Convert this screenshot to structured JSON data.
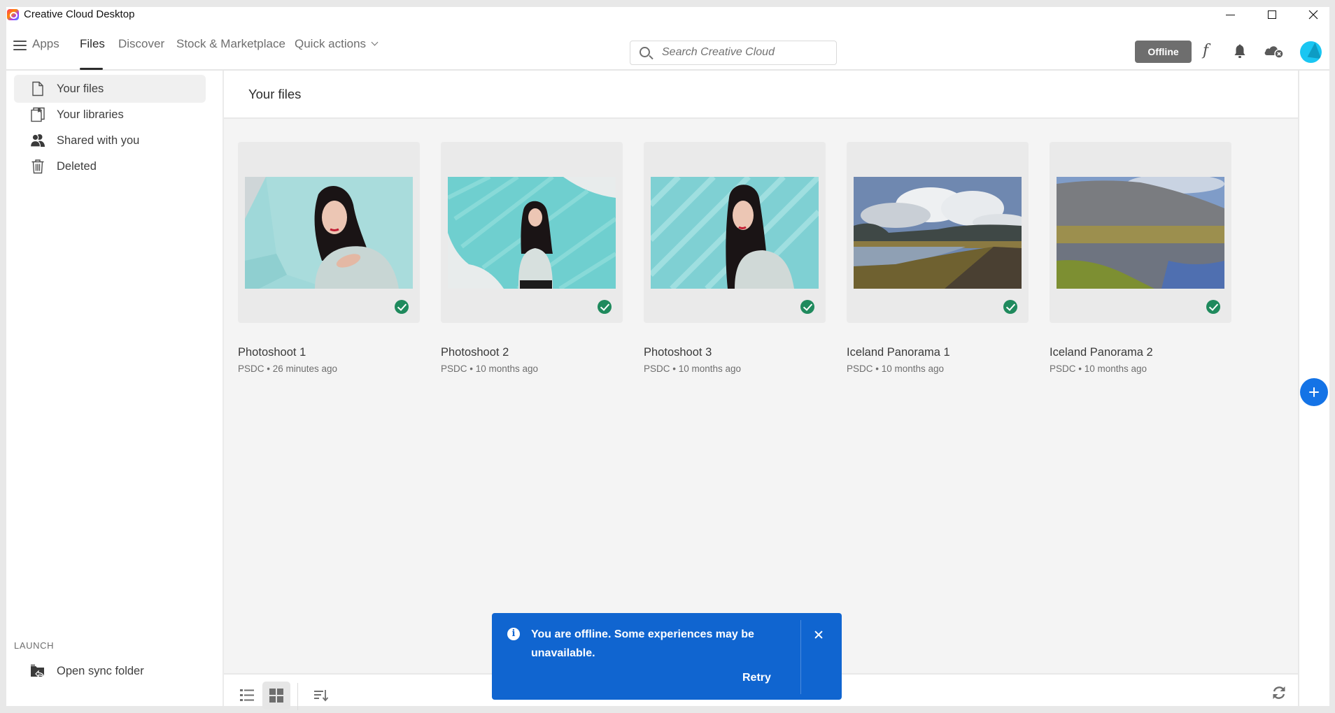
{
  "window": {
    "title": "Creative Cloud Desktop",
    "controls": {
      "minimize": "minimize",
      "maximize": "maximize",
      "close": "close"
    }
  },
  "nav": {
    "tabs": [
      {
        "label": "Apps",
        "active": false
      },
      {
        "label": "Files",
        "active": true
      },
      {
        "label": "Discover",
        "active": false
      },
      {
        "label": "Stock & Marketplace",
        "active": false
      },
      {
        "label": "Quick actions",
        "active": false,
        "dropdown": true
      }
    ],
    "search": {
      "placeholder": "Search Creative Cloud",
      "value": ""
    },
    "status_button": "Offline",
    "icons": [
      "fonts-icon",
      "bell-icon",
      "cloud-offline-icon",
      "avatar"
    ],
    "font_glyph": "f"
  },
  "sidebar": {
    "items": [
      {
        "label": "Your files",
        "icon": "file-icon",
        "active": true
      },
      {
        "label": "Your libraries",
        "icon": "libraries-icon",
        "active": false
      },
      {
        "label": "Shared with you",
        "icon": "people-icon",
        "active": false
      },
      {
        "label": "Deleted",
        "icon": "trash-icon",
        "active": false
      }
    ],
    "section_label": "LAUNCH",
    "launch_items": [
      {
        "label": "Open sync folder",
        "icon": "sync-folder-icon"
      }
    ]
  },
  "main": {
    "title": "Your files",
    "files": [
      {
        "name": "Photoshoot 1",
        "meta": "PSDC • 26 minutes ago",
        "synced": true
      },
      {
        "name": "Photoshoot 2",
        "meta": "PSDC • 10 months ago",
        "synced": true
      },
      {
        "name": "Photoshoot 3",
        "meta": "PSDC • 10 months ago",
        "synced": true
      },
      {
        "name": "Iceland Panorama 1",
        "meta": "PSDC • 10 months ago",
        "synced": true
      },
      {
        "name": "Iceland Panorama 2",
        "meta": "PSDC • 10 months ago",
        "synced": true
      }
    ],
    "view_mode": "grid"
  },
  "toast": {
    "message": "You are offline. Some experiences may be unavailable.",
    "action": "Retry",
    "color": "#1065d0"
  },
  "colors": {
    "accent": "#1473e6",
    "synced": "#1f8a5d",
    "offline_badge": "#6e6e6e"
  }
}
